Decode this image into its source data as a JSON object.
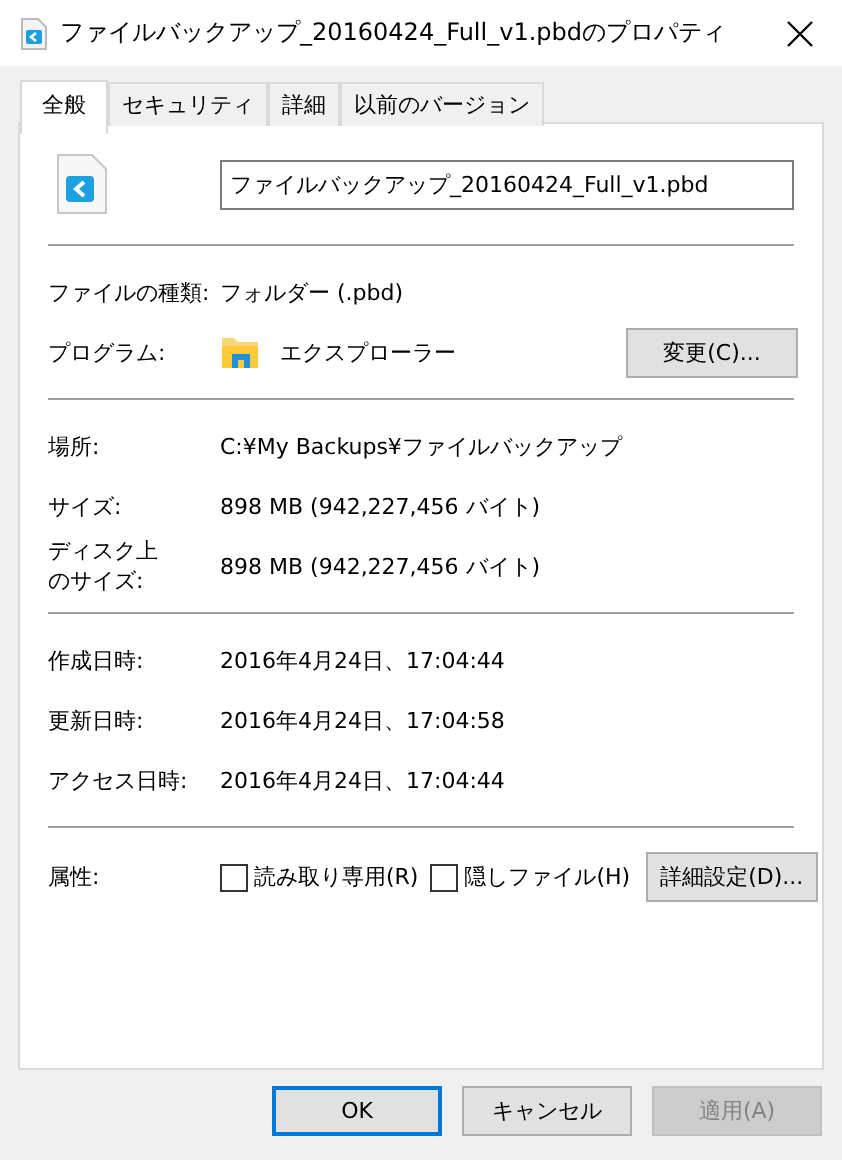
{
  "window": {
    "title": "ファイルバックアップ_20160424_Full_v1.pbdのプロパティ"
  },
  "tabs": [
    {
      "label": "全般",
      "selected": true
    },
    {
      "label": "セキュリティ",
      "selected": false
    },
    {
      "label": "詳細",
      "selected": false
    },
    {
      "label": "以前のバージョン",
      "selected": false
    }
  ],
  "file_name": "ファイルバックアップ_20160424_Full_v1.pbd",
  "sections": [
    [
      {
        "kind": "text",
        "label": "ファイルの種類:",
        "value": "フォルダー (.pbd)"
      },
      {
        "kind": "program",
        "label": "プログラム:",
        "value": "エクスプローラー",
        "button": "変更(C)..."
      }
    ],
    [
      {
        "kind": "text",
        "label": "場所:",
        "value": "C:¥My Backups¥ファイルバックアップ"
      },
      {
        "kind": "text",
        "label": "サイズ:",
        "value": "898 MB (942,227,456 バイト)"
      },
      {
        "kind": "text",
        "label": "ディスク上のサイズ:",
        "wrapped": true,
        "value": "898 MB (942,227,456 バイト)"
      }
    ],
    [
      {
        "kind": "text",
        "label": "作成日時:",
        "value": "2016年4月24日、17:04:44"
      },
      {
        "kind": "text",
        "label": "更新日時:",
        "value": "2016年4月24日、17:04:58"
      },
      {
        "kind": "text",
        "label": "アクセス日時:",
        "value": "2016年4月24日、17:04:44"
      }
    ]
  ],
  "attributes": {
    "label": "属性:",
    "checkboxes": [
      {
        "label": "読み取り専用(R)",
        "checked": false
      },
      {
        "label": "隠しファイル(H)",
        "checked": false
      }
    ],
    "button": "詳細設定(D)..."
  },
  "buttons": [
    {
      "label": "OK",
      "default": true,
      "disabled": false
    },
    {
      "label": "キャンセル",
      "default": false,
      "disabled": false
    },
    {
      "label": "適用(A)",
      "default": false,
      "disabled": true
    }
  ]
}
